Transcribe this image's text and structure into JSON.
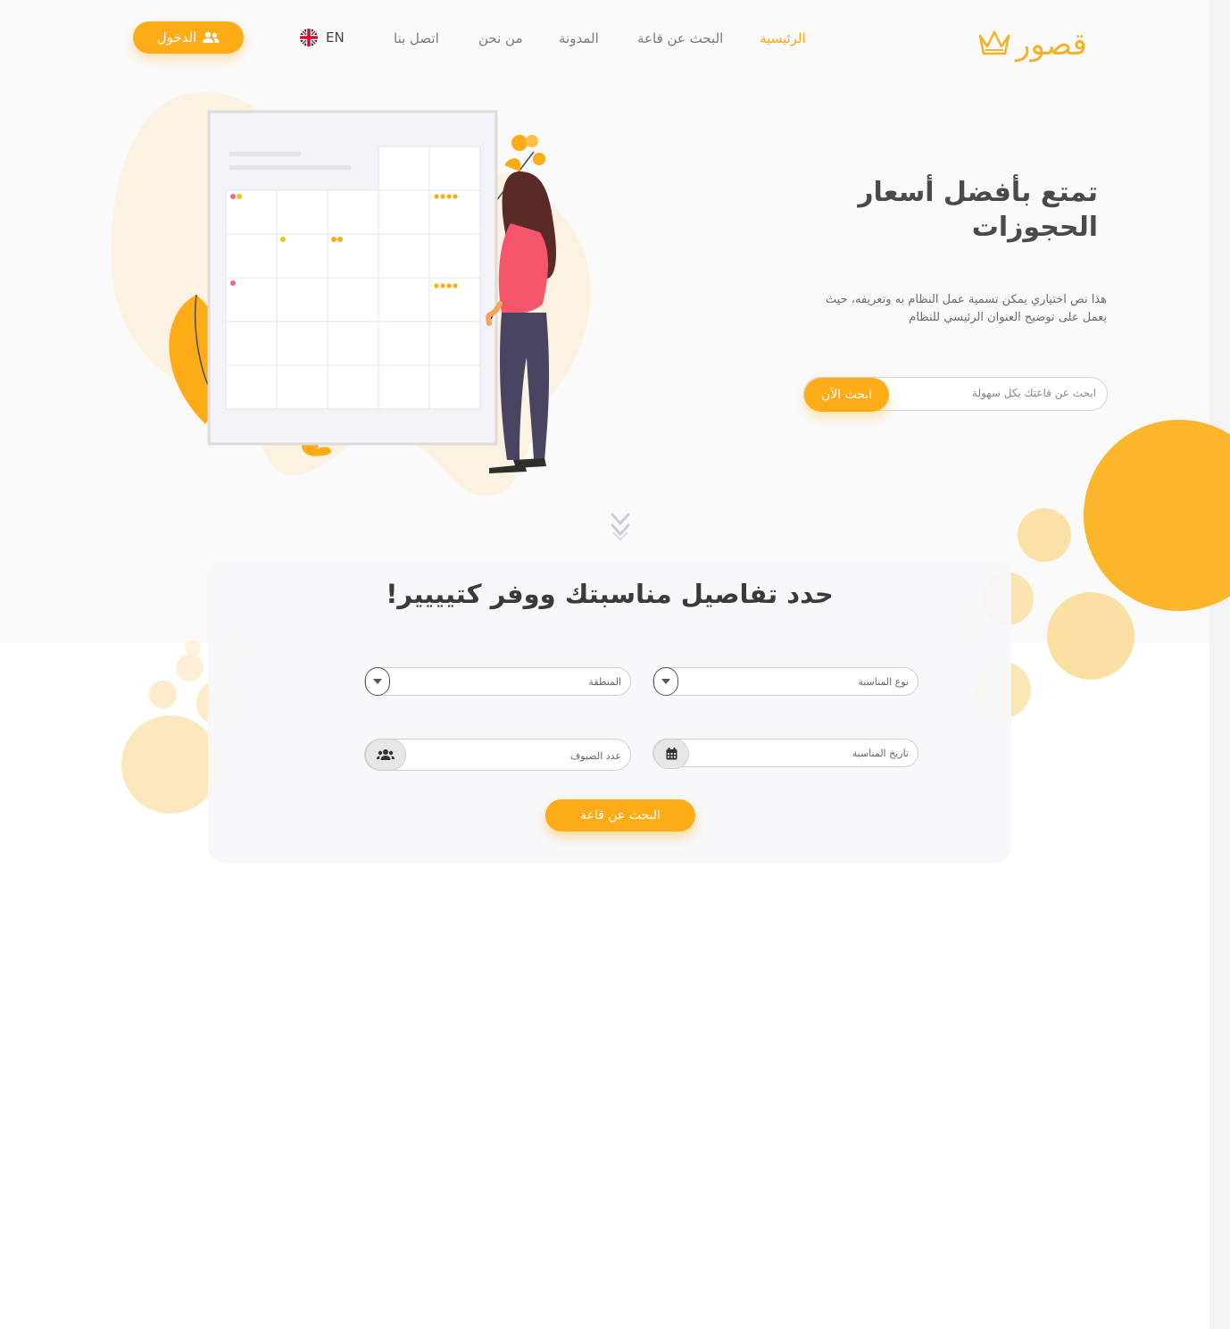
{
  "brand": {
    "logo_text": "قصور",
    "accent": "#fdab17"
  },
  "nav": {
    "items": [
      {
        "label": "الرئيسية",
        "active": true
      },
      {
        "label": "البحث عن قاعة",
        "active": false
      },
      {
        "label": "المدونة",
        "active": false
      },
      {
        "label": "من نحن",
        "active": false
      },
      {
        "label": "اتصل بنا",
        "active": false
      }
    ],
    "lang_label": "EN",
    "login_label": "الدخول"
  },
  "hero": {
    "title_line1": "تمتع بأفضل أسعار",
    "title_line2": "الحجوزات",
    "desc_line1": "هذا نص اختياري يمكن تسمية عمل النظام به وتعريفه، حيث",
    "desc_line2": "يعمل على توضيح العنوان الرئيسي للنظام",
    "search_placeholder": "ابحث عن قاعتك بكل سهولة",
    "search_button": "ابحث الآن"
  },
  "search_card": {
    "title": "حدد تفاصيل مناسبتك ووفر كتيييير!",
    "fields": {
      "event_type": "نوع المناسبة",
      "region": "المنطقة",
      "event_date": "تاريخ المناسبة",
      "guests": "عدد الضيوف"
    },
    "submit_label": "البحث عن قاعة"
  }
}
